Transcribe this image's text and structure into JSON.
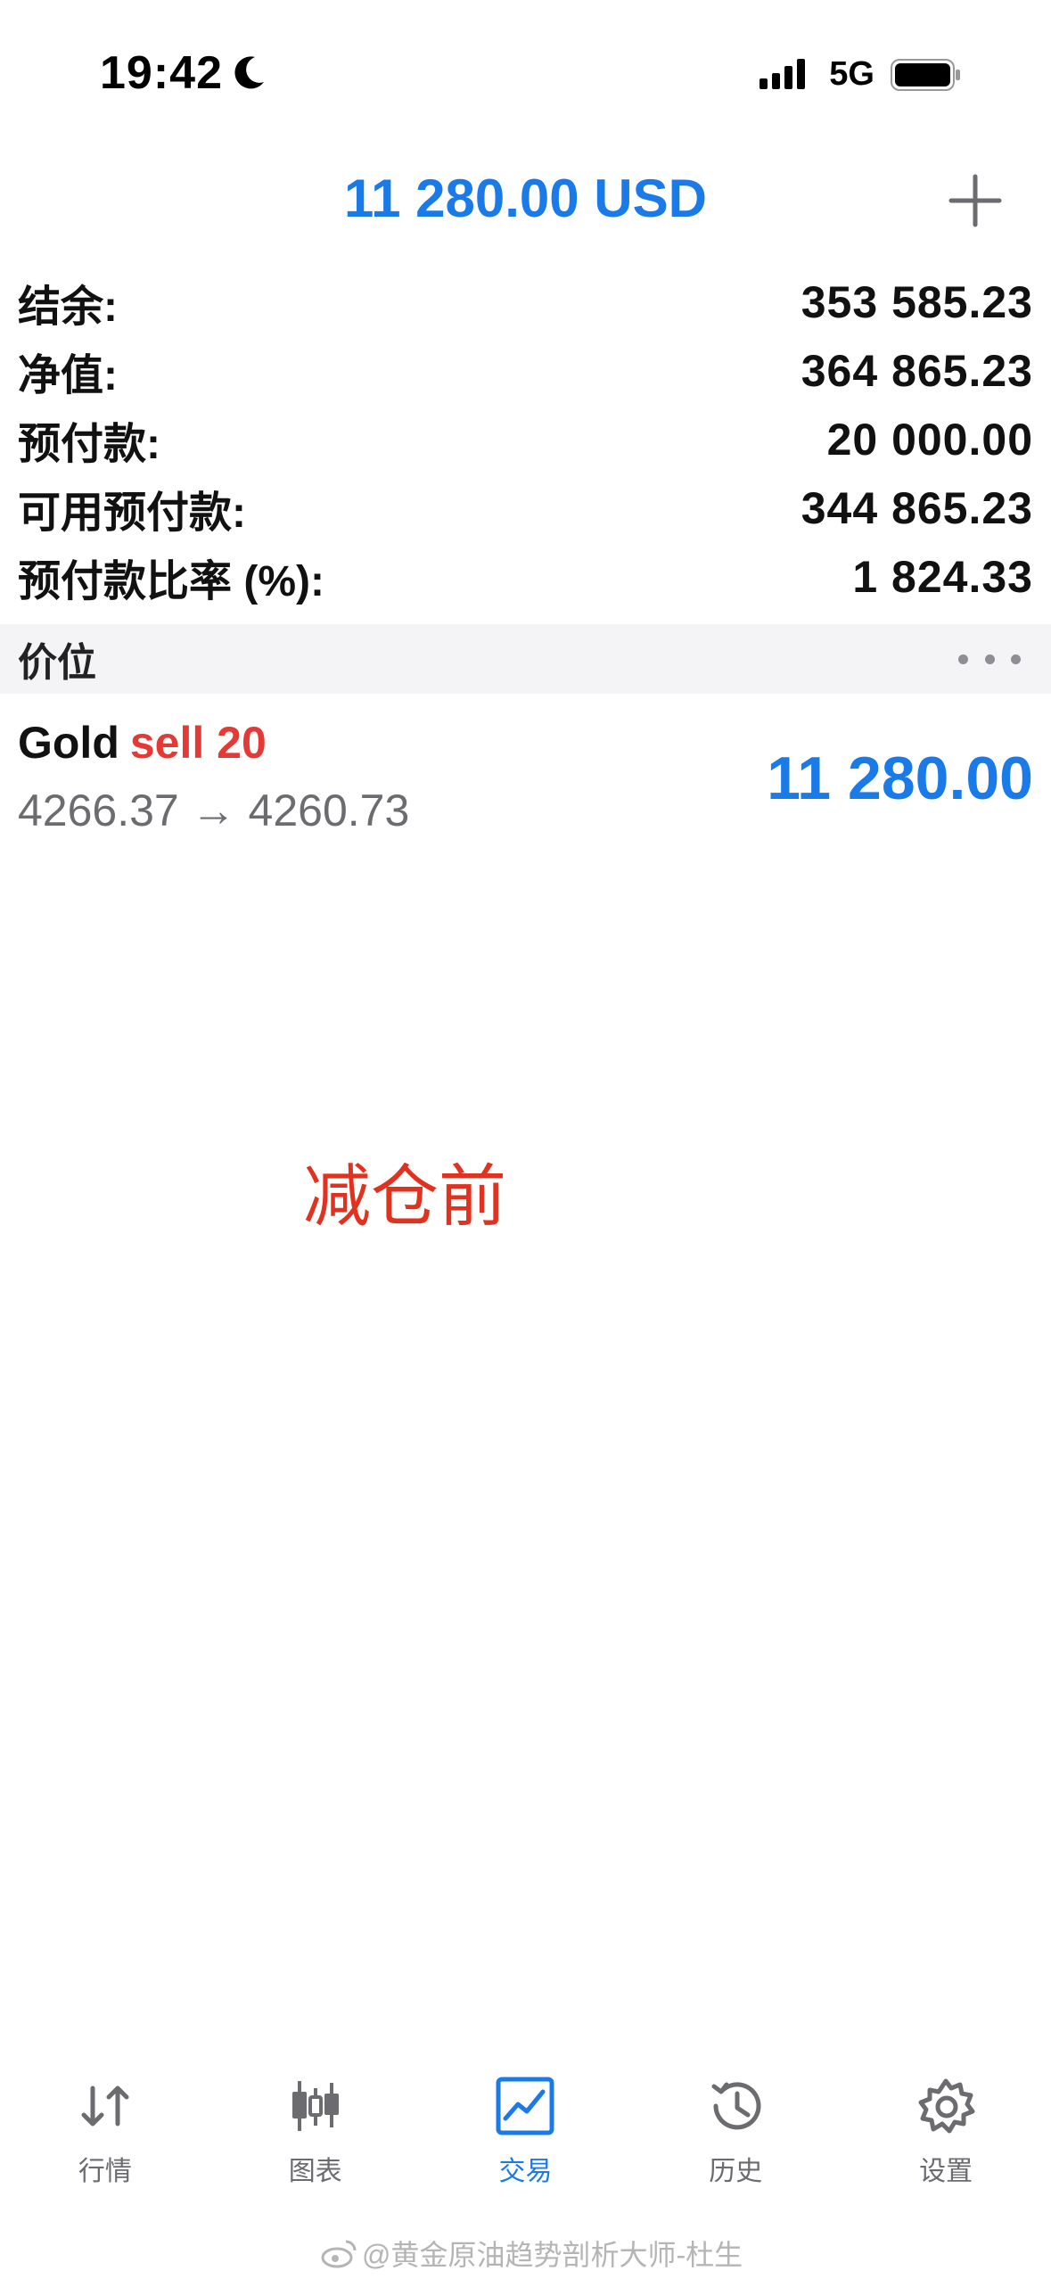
{
  "status_bar": {
    "time": "19:42",
    "network": "5G"
  },
  "header": {
    "profit": "11 280.00 USD"
  },
  "summary": [
    {
      "label": "结余:",
      "value": "353 585.23"
    },
    {
      "label": "净值:",
      "value": "364 865.23"
    },
    {
      "label": "预付款:",
      "value": "20 000.00"
    },
    {
      "label": "可用预付款:",
      "value": "344 865.23"
    },
    {
      "label": "预付款比率 (%):",
      "value": "1 824.33"
    }
  ],
  "section": {
    "title": "价位"
  },
  "position": {
    "symbol": "Gold",
    "side_volume": "sell 20",
    "prices": "4266.37 → 4260.73",
    "profit": "11 280.00"
  },
  "annotation": "减仓前",
  "tabs": [
    {
      "label": "行情",
      "icon": "quotes-arrows-icon",
      "active": false
    },
    {
      "label": "图表",
      "icon": "candlestick-chart-icon",
      "active": false
    },
    {
      "label": "交易",
      "icon": "trade-chart-icon",
      "active": true
    },
    {
      "label": "历史",
      "icon": "history-clock-icon",
      "active": false
    },
    {
      "label": "设置",
      "icon": "gear-icon",
      "active": false
    }
  ],
  "watermark": "@黄金原油趋势剖析大师-杜生",
  "colors": {
    "accent_blue": "#1a7be8",
    "sell_red": "#e53935",
    "annotation_red": "#e0321e",
    "inactive_gray": "#6b6b70"
  }
}
